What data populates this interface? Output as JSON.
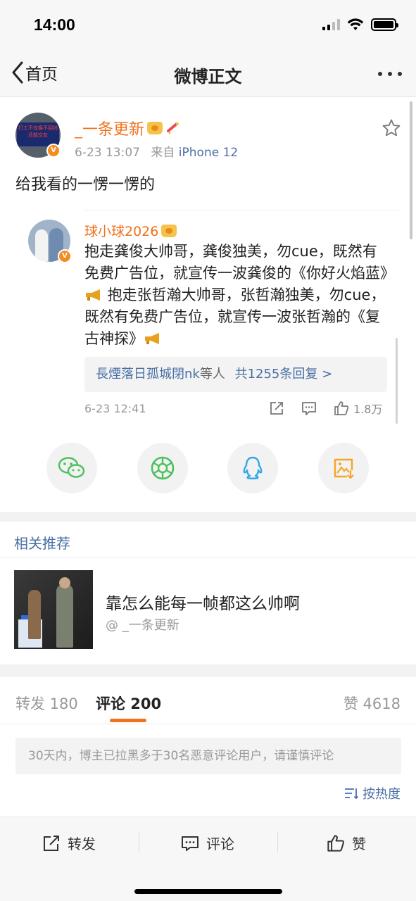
{
  "status_bar": {
    "time": "14:00"
  },
  "nav": {
    "back_label": "首页",
    "title": "微博正文"
  },
  "post": {
    "avatar_sign_text": "打工不仅换不回钱还能交友",
    "author": "_一条更新",
    "time": "6-23 13:07",
    "source_prefix": "来自",
    "device": "iPhone 12",
    "text": "给我看的一愣一愣的"
  },
  "hot_comment": {
    "author": "球小球2026",
    "text_part1": "抱走龚俊大帅哥，龚俊独美，勿cue，既然有免费广告位，就宣传一波龚俊的《你好火焰蓝》",
    "text_part2": " 抱走张哲瀚大帅哥，张哲瀚独美，勿cue，既然有免费广告位，就宣传一波张哲瀚的《复古神探》",
    "replies_user": "長煙落日孤城閉nk",
    "replies_mid": "等人",
    "replies_count_text": "共1255条回复 >",
    "time": "6-23 12:41",
    "likes": "1.8万"
  },
  "share_buttons": [
    {
      "icon": "wechat-icon",
      "color": "#4cc15c"
    },
    {
      "icon": "moments-icon",
      "color": "#4cc15c"
    },
    {
      "icon": "qq-icon",
      "color": "#2fa8e8"
    },
    {
      "icon": "save-image-icon",
      "color": "#f5a623"
    }
  ],
  "related": {
    "section_title": "相关推荐",
    "title": "靠怎么能每一帧都这么帅啊",
    "author": "@ _一条更新"
  },
  "tabs": {
    "repost": "转发 180",
    "comments": "评论 200",
    "likes": "赞 4618"
  },
  "notice": "30天内，博主已拉黑多于30名恶意评论用户，请谨慎评论",
  "sort_label": "按热度",
  "bottom_bar": {
    "repost": "转发",
    "comment": "评论",
    "like": "赞"
  },
  "colors": {
    "accent": "#f0721a",
    "link": "#4a6fa5"
  }
}
